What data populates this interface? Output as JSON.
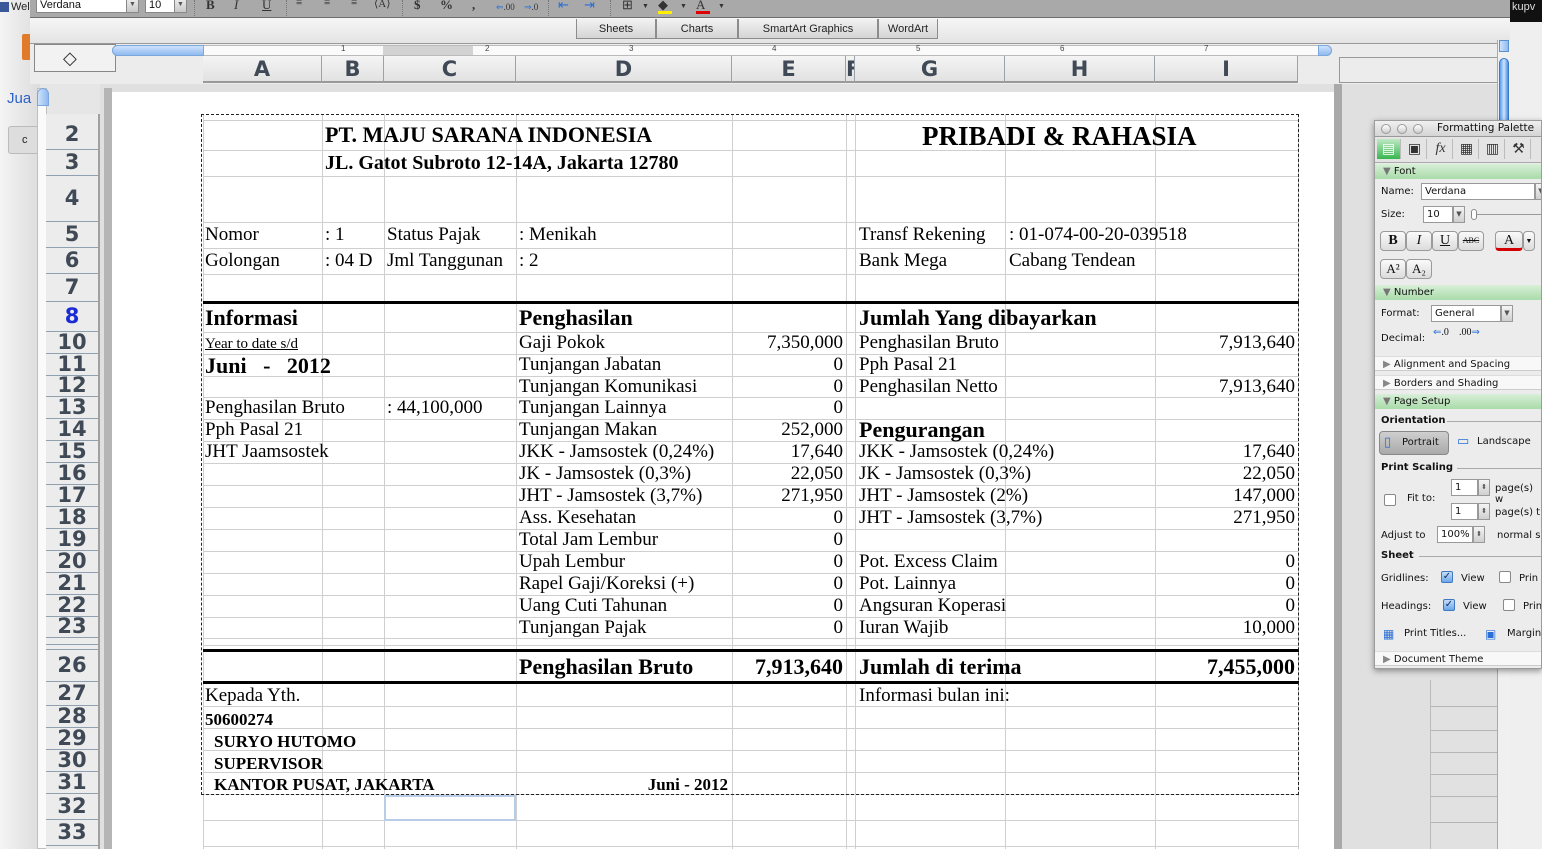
{
  "background": {
    "left_app_title": "Wel",
    "left_app_link": "Jua",
    "left_app_button": "c",
    "right_app_text": "kupv"
  },
  "toolbar": {
    "font_name": "Verdana",
    "font_size": "10",
    "bold": "B",
    "italic": "I",
    "underline": "U",
    "currency": "$",
    "percent": "%",
    "comma": ",",
    "increase_decimal": ".00",
    "decrease_decimal": ".0",
    "fill_color": "#ffee00",
    "font_color": "#e00000"
  },
  "gallery_tabs": [
    "Sheets",
    "Charts",
    "SmartArt Graphics",
    "WordArt"
  ],
  "ruler": {
    "marks": [
      "1",
      "2",
      "3",
      "4",
      "5",
      "6",
      "7"
    ]
  },
  "columns": [
    "A",
    "B",
    "C",
    "D",
    "E",
    "F",
    "G",
    "H",
    "I"
  ],
  "rows": [
    "2",
    "3",
    "4",
    "5",
    "6",
    "7",
    "8",
    "10",
    "11",
    "12",
    "13",
    "14",
    "15",
    "16",
    "17",
    "18",
    "19",
    "20",
    "21",
    "22",
    "23",
    "",
    "",
    "26",
    "27",
    "28",
    "29",
    "30",
    "31",
    "32",
    "33"
  ],
  "selected_row": "8",
  "sheet": {
    "company_name": "PT. MAJU SARANA INDONESIA",
    "company_address": "JL. Gatot Subroto 12-14A, Jakarta 12780",
    "confidential": "PRIBADI & RAHASIA",
    "info": {
      "nomor_label": "Nomor",
      "nomor_value": ": 1",
      "status_label": "Status Pajak",
      "status_value": ": Menikah",
      "golongan_label": "Golongan",
      "golongan_value": ": 04 D",
      "tanggungan_label": "Jml Tanggunan",
      "tanggungan_value": ": 2",
      "rekening_label": "Transf Rekening",
      "rekening_value": ": 01-074-00-20-039518",
      "bank_label": "Bank Mega",
      "bank_branch": "Cabang Tendean"
    },
    "informasi": {
      "title": "Informasi",
      "ytd_label": "Year to date s/d",
      "period": "Juni   -   2012",
      "items": [
        {
          "label": "Penghasilan Bruto",
          "value": ": 44,100,000"
        },
        {
          "label": "Pph Pasal 21",
          "value": ""
        },
        {
          "label": "JHT Jaamsostek",
          "value": ""
        }
      ]
    },
    "penghasilan": {
      "title": "Penghasilan",
      "items": [
        {
          "label": "Gaji Pokok",
          "value": "7,350,000"
        },
        {
          "label": "Tunjangan Jabatan",
          "value": "0"
        },
        {
          "label": "Tunjangan Komunikasi",
          "value": "0"
        },
        {
          "label": "Tunjangan Lainnya",
          "value": "0"
        },
        {
          "label": "Tunjangan Makan",
          "value": "252,000"
        },
        {
          "label": "JKK - Jamsostek (0,24%)",
          "value": "17,640"
        },
        {
          "label": "JK - Jamsostek (0,3%)",
          "value": "22,050"
        },
        {
          "label": "JHT - Jamsostek (3,7%)",
          "value": "271,950"
        },
        {
          "label": "Ass. Kesehatan",
          "value": "0"
        },
        {
          "label": "Total Jam Lembur",
          "value": "0"
        },
        {
          "label": "Upah Lembur",
          "value": "0"
        },
        {
          "label": "Rapel Gaji/Koreksi (+)",
          "value": "0"
        },
        {
          "label": "Uang Cuti Tahunan",
          "value": "0"
        },
        {
          "label": "Tunjangan Pajak",
          "value": "0"
        }
      ],
      "total_label": "Penghasilan Bruto",
      "total_value": "7,913,640"
    },
    "dibayarkan": {
      "title": "Jumlah Yang dibayarkan",
      "items": [
        {
          "label": "Penghasilan Bruto",
          "value": "7,913,640"
        },
        {
          "label": "Pph Pasal 21",
          "value": ""
        },
        {
          "label": "Penghasilan Netto",
          "value": "7,913,640"
        }
      ]
    },
    "pengurangan": {
      "title": "Pengurangan",
      "items": [
        {
          "label": "JKK - Jamsostek (0,24%)",
          "value": "17,640"
        },
        {
          "label": "JK - Jamsostek (0,3%)",
          "value": "22,050"
        },
        {
          "label": "JHT - Jamsostek (2%)",
          "value": "147,000"
        },
        {
          "label": "JHT - Jamsostek (3,7%)",
          "value": "271,950"
        },
        {
          "label": "",
          "value": ""
        },
        {
          "label": "Pot. Excess Claim",
          "value": "0"
        },
        {
          "label": "Pot. Lainnya",
          "value": "0"
        },
        {
          "label": "Angsuran Koperasi",
          "value": "0"
        },
        {
          "label": "Iuran Wajib",
          "value": "10,000"
        }
      ],
      "total_label": "Jumlah di terima",
      "total_value": "7,455,000"
    },
    "recipient": {
      "greeting": "Kepada Yth.",
      "employee_id": "50600274",
      "name": "SURYO HUTOMO",
      "position": "SUPERVISOR",
      "office": "KANTOR PUSAT, JAKARTA",
      "period": "Juni - 2012"
    },
    "info_bulan_label": "Informasi bulan ini:"
  },
  "palette": {
    "title": "Formatting Palette",
    "sections": {
      "font": "Font",
      "number": "Number",
      "alignment": "Alignment and Spacing",
      "borders": "Borders and Shading",
      "page_setup": "Page Setup",
      "theme": "Document Theme"
    },
    "font": {
      "name_label": "Name:",
      "name_value": "Verdana",
      "size_label": "Size:",
      "size_value": "10",
      "bold": "B",
      "italic": "I",
      "underline": "U",
      "strike": "ABC",
      "color_btn": "A",
      "superscript": "A²",
      "subscript": "A₂"
    },
    "number": {
      "format_label": "Format:",
      "format_value": "General",
      "decimal_label": "Decimal:"
    },
    "page_setup": {
      "orientation_label": "Orientation",
      "portrait": "Portrait",
      "landscape": "Landscape",
      "orientation_selected": "Portrait",
      "print_scaling_label": "Print Scaling",
      "fit_to_label": "Fit to:",
      "fit_to_checked": false,
      "fit_wide_value": "1",
      "fit_wide_label": "page(s) w",
      "fit_tall_value": "1",
      "fit_tall_label": "page(s) t",
      "adjust_label": "Adjust to",
      "adjust_value": "100%",
      "adjust_suffix": "normal s",
      "sheet_label": "Sheet",
      "gridlines_label": "Gridlines:",
      "gridlines_view": true,
      "gridlines_print": false,
      "headings_label": "Headings:",
      "headings_view": true,
      "headings_print": false,
      "view_label": "View",
      "print_label": "Prin",
      "print_titles": "Print Titles...",
      "margins": "Margin"
    }
  }
}
